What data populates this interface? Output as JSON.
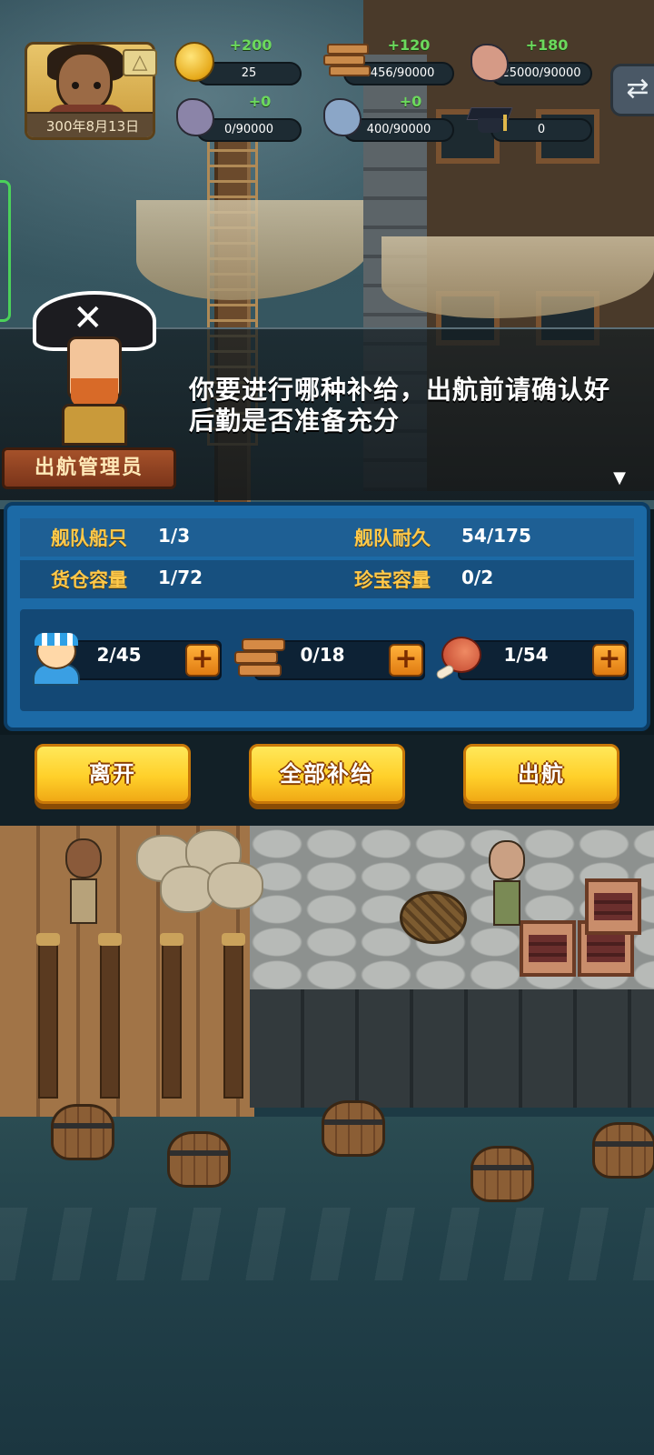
{
  "player": {
    "date": "300年8月13日"
  },
  "resources": [
    {
      "id": "gold",
      "icon": "gold-coin-icon",
      "delta": "+200",
      "value": "25"
    },
    {
      "id": "wood",
      "icon": "wood-planks-icon",
      "delta": "+120",
      "value": "4456/90000"
    },
    {
      "id": "stone",
      "icon": "pink-ore-icon",
      "delta": "+180",
      "value": "25000/90000"
    },
    {
      "id": "iron",
      "icon": "purple-ore-icon",
      "delta": "+0",
      "value": "0/90000"
    },
    {
      "id": "crystal",
      "icon": "blue-ore-icon",
      "delta": "+0",
      "value": "400/90000"
    },
    {
      "id": "knowledge",
      "icon": "graduation-cap-icon",
      "delta": "",
      "value": "0"
    }
  ],
  "dialog": {
    "text": "你要进行哪种补给，出航前请确认好后勤是否准备充分",
    "speaker": "出航管理员"
  },
  "fleet": {
    "ships_label": "舰队船只",
    "ships_value": "1/3",
    "durability_label": "舰队耐久",
    "durability_value": "54/175",
    "cargo_label": "货仓容量",
    "cargo_value": "1/72",
    "treasure_label": "珍宝容量",
    "treasure_value": "0/2"
  },
  "supplies": [
    {
      "id": "sailors",
      "icon": "sailor-icon",
      "value": "2/45"
    },
    {
      "id": "timber",
      "icon": "timber-icon",
      "value": "0/18"
    },
    {
      "id": "food",
      "icon": "meat-icon",
      "value": "1/54"
    }
  ],
  "buttons": {
    "leave": "离开",
    "resupply_all": "全部补给",
    "set_sail": "出航"
  },
  "colors": {
    "panel_blue": "#1c6aa6",
    "stat_label_gold": "#ffc94a",
    "button_yellow": "#ffd02a",
    "delta_green": "#6cd95d"
  }
}
